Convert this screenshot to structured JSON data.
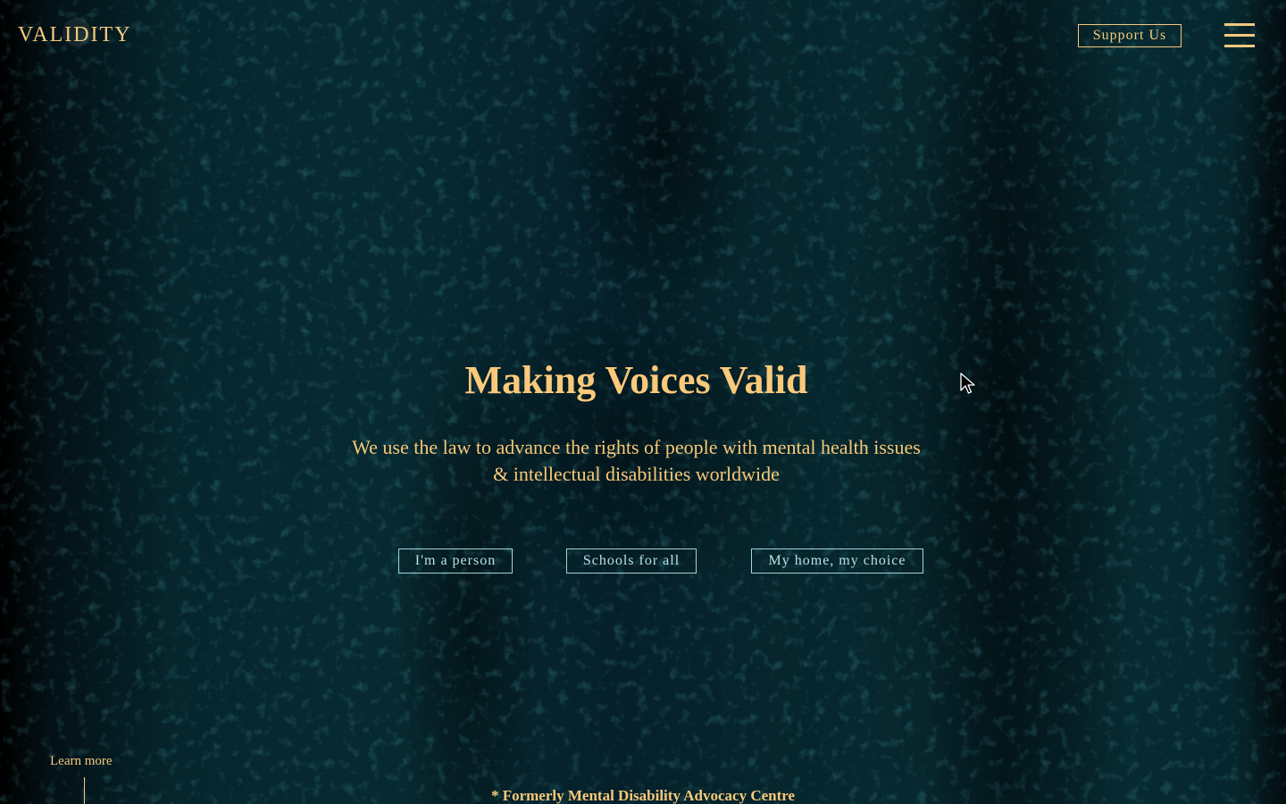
{
  "header": {
    "logo": "VALIDITY",
    "support_label": "Support Us",
    "menu_icon": "hamburger-menu-icon"
  },
  "hero": {
    "title": "Making Voices Valid",
    "subtitle_line1": "We use the law to advance the rights of people with mental health issues",
    "subtitle_line2": "& intellectual disabilities worldwide"
  },
  "campaigns": [
    {
      "label": "I'm a person"
    },
    {
      "label": "Schools for all"
    },
    {
      "label": "My home, my choice"
    }
  ],
  "footer": {
    "learn_more": "Learn more",
    "formerly_note": "* Formerly Mental Disability Advocacy Centre"
  },
  "colors": {
    "accent_gold": "#f4c97e",
    "pill_teal": "#9fd6d8",
    "background": "#06252c"
  }
}
